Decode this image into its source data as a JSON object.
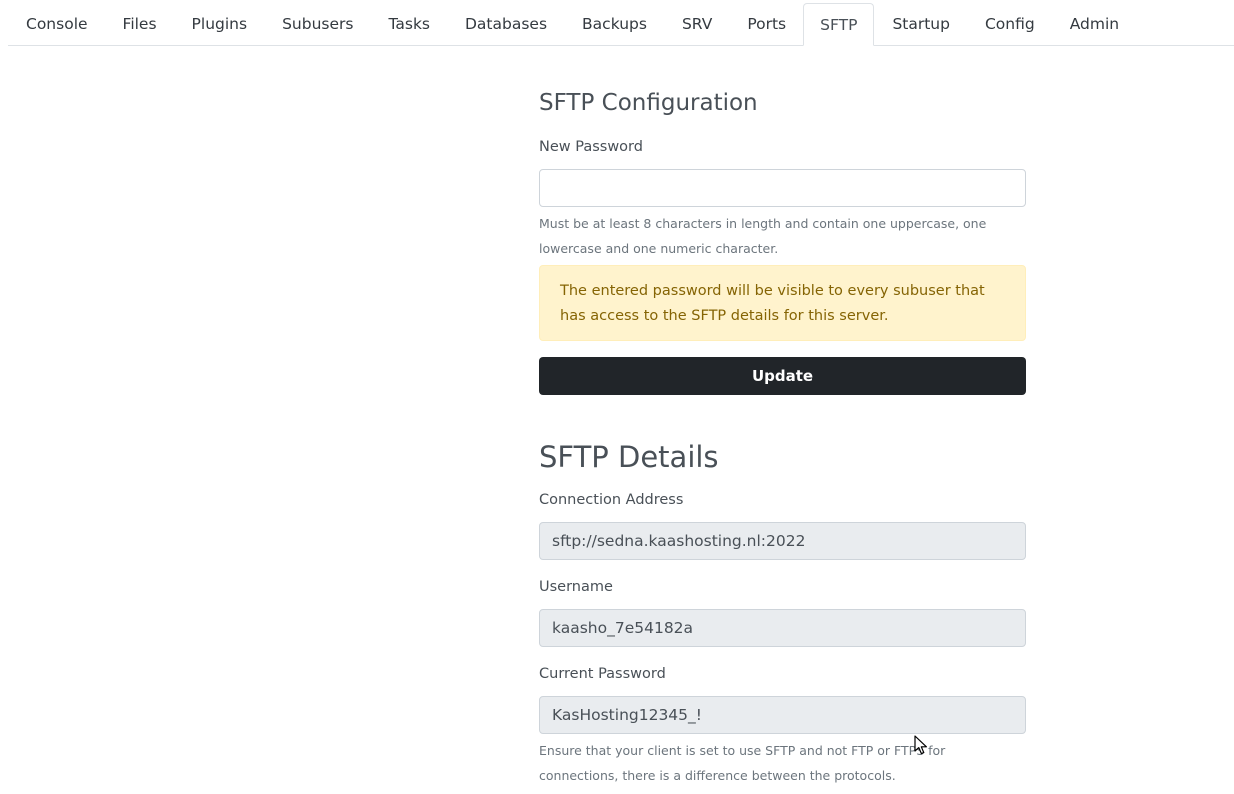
{
  "tabs": [
    {
      "label": "Console",
      "active": false
    },
    {
      "label": "Files",
      "active": false
    },
    {
      "label": "Plugins",
      "active": false
    },
    {
      "label": "Subusers",
      "active": false
    },
    {
      "label": "Tasks",
      "active": false
    },
    {
      "label": "Databases",
      "active": false
    },
    {
      "label": "Backups",
      "active": false
    },
    {
      "label": "SRV",
      "active": false
    },
    {
      "label": "Ports",
      "active": false
    },
    {
      "label": "SFTP",
      "active": true
    },
    {
      "label": "Startup",
      "active": false
    },
    {
      "label": "Config",
      "active": false
    },
    {
      "label": "Admin",
      "active": false
    }
  ],
  "config": {
    "title": "SFTP Configuration",
    "new_password_label": "New Password",
    "new_password_value": "",
    "password_help": "Must be at least 8 characters in length and contain one uppercase, one lowercase and one numeric character.",
    "warning": "The entered password will be visible to every subuser that has access to the SFTP details for this server.",
    "update_label": "Update"
  },
  "details": {
    "title": "SFTP Details",
    "address_label": "Connection Address",
    "address_value": "sftp://sedna.kaashosting.nl:2022",
    "username_label": "Username",
    "username_value": "kaasho_7e54182a",
    "current_password_label": "Current Password",
    "current_password_value": "KasHosting12345_!",
    "protocol_help": "Ensure that your client is set to use SFTP and not FTP or FTPS for connections, there is a difference between the protocols."
  },
  "colors": {
    "button_bg": "#212529",
    "warning_bg": "#fff3cd",
    "warning_text": "#856404",
    "readonly_bg": "#e9ecef"
  },
  "icons": {
    "cursor": "mouse-pointer-icon"
  }
}
